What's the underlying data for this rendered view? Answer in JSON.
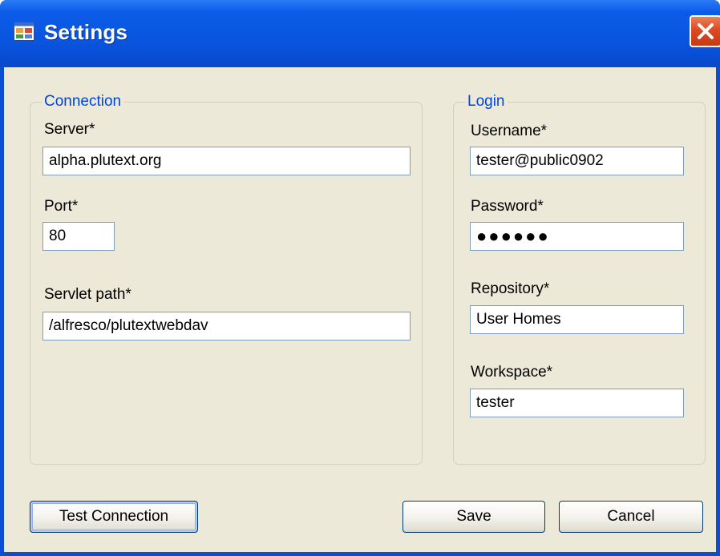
{
  "window": {
    "title": "Settings"
  },
  "connection": {
    "group_title": "Connection",
    "server_label": "Server*",
    "server_value": "alpha.plutext.org",
    "port_label": "Port*",
    "port_value": "80",
    "servlet_label": "Servlet path*",
    "servlet_value": "/alfresco/plutextwebdav"
  },
  "login": {
    "group_title": "Login",
    "username_label": "Username*",
    "username_value": "tester@public0902",
    "password_label": "Password*",
    "password_value": "●●●●●●",
    "repository_label": "Repository*",
    "repository_value": "User Homes",
    "workspace_label": "Workspace*",
    "workspace_value": "tester"
  },
  "buttons": {
    "test_connection": "Test Connection",
    "save": "Save",
    "cancel": "Cancel"
  },
  "colors": {
    "titlebar": "#0a55e0",
    "dialog_background": "#ece9d8",
    "group_title": "#0046d5",
    "close_button": "#dc4a22"
  },
  "icons": {
    "title": "settings-window-icon",
    "close": "close-icon"
  }
}
